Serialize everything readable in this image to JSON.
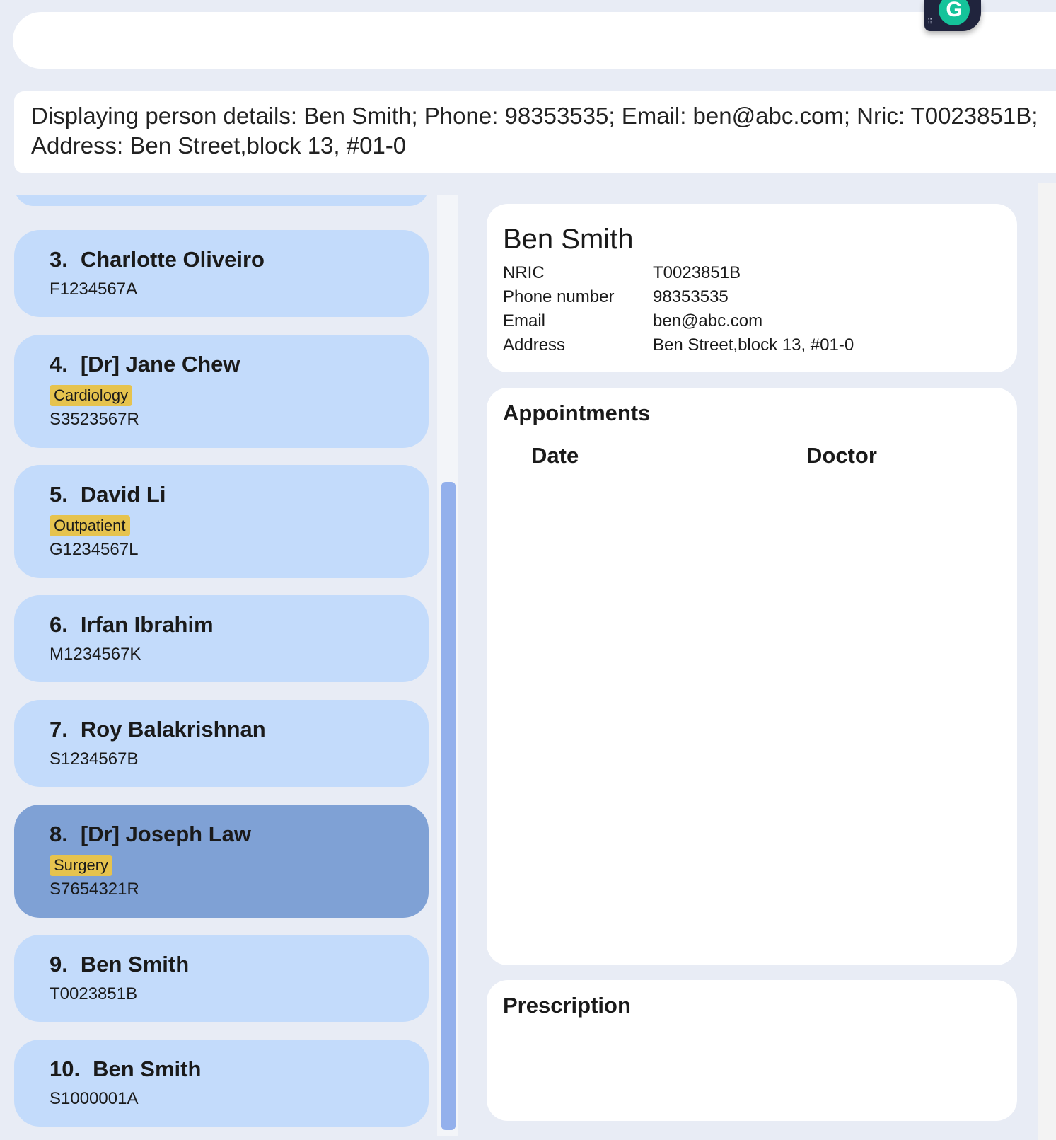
{
  "command_box": {
    "value": ""
  },
  "result_display": {
    "text": "Displaying person details: Ben Smith; Phone: 98353535; Email: ben@abc.com; Nric: T0023851B; Address: Ben Street,block 13, #01-0"
  },
  "overlay": {
    "icon": "grammarly-icon",
    "glyph": "G"
  },
  "person_list": [
    {
      "index": "3.",
      "name": "Charlotte Oliveiro",
      "tags": [],
      "nric": "F1234567A"
    },
    {
      "index": "4.",
      "name": "[Dr] Jane Chew",
      "tags": [
        "Cardiology"
      ],
      "nric": "S3523567R"
    },
    {
      "index": "5.",
      "name": "David Li",
      "tags": [
        "Outpatient"
      ],
      "nric": "G1234567L"
    },
    {
      "index": "6.",
      "name": "Irfan Ibrahim",
      "tags": [],
      "nric": "M1234567K"
    },
    {
      "index": "7.",
      "name": "Roy Balakrishnan",
      "tags": [],
      "nric": "S1234567B"
    },
    {
      "index": "8.",
      "name": "[Dr] Joseph Law",
      "tags": [
        "Surgery"
      ],
      "nric": "S7654321R",
      "selected": true
    },
    {
      "index": "9.",
      "name": "Ben Smith",
      "tags": [],
      "nric": "T0023851B"
    },
    {
      "index": "10.",
      "name": "Ben Smith",
      "tags": [],
      "nric": "S1000001A"
    }
  ],
  "details": {
    "name": "Ben Smith",
    "fields": [
      {
        "label": "NRIC",
        "value": "T0023851B"
      },
      {
        "label": "Phone number",
        "value": "98353535"
      },
      {
        "label": "Email",
        "value": "ben@abc.com"
      },
      {
        "label": "Address",
        "value": "Ben Street,block 13, #01-0"
      }
    ]
  },
  "appointments": {
    "title": "Appointments",
    "columns": [
      "Date",
      "Doctor"
    ],
    "rows": []
  },
  "prescription": {
    "title": "Prescription"
  },
  "colors": {
    "card": "#c3dbfb",
    "card_selected": "#7fa1d5",
    "tag": "#e6c34e",
    "background": "#e8ecf5",
    "scroll_thumb": "#93b0ec"
  }
}
